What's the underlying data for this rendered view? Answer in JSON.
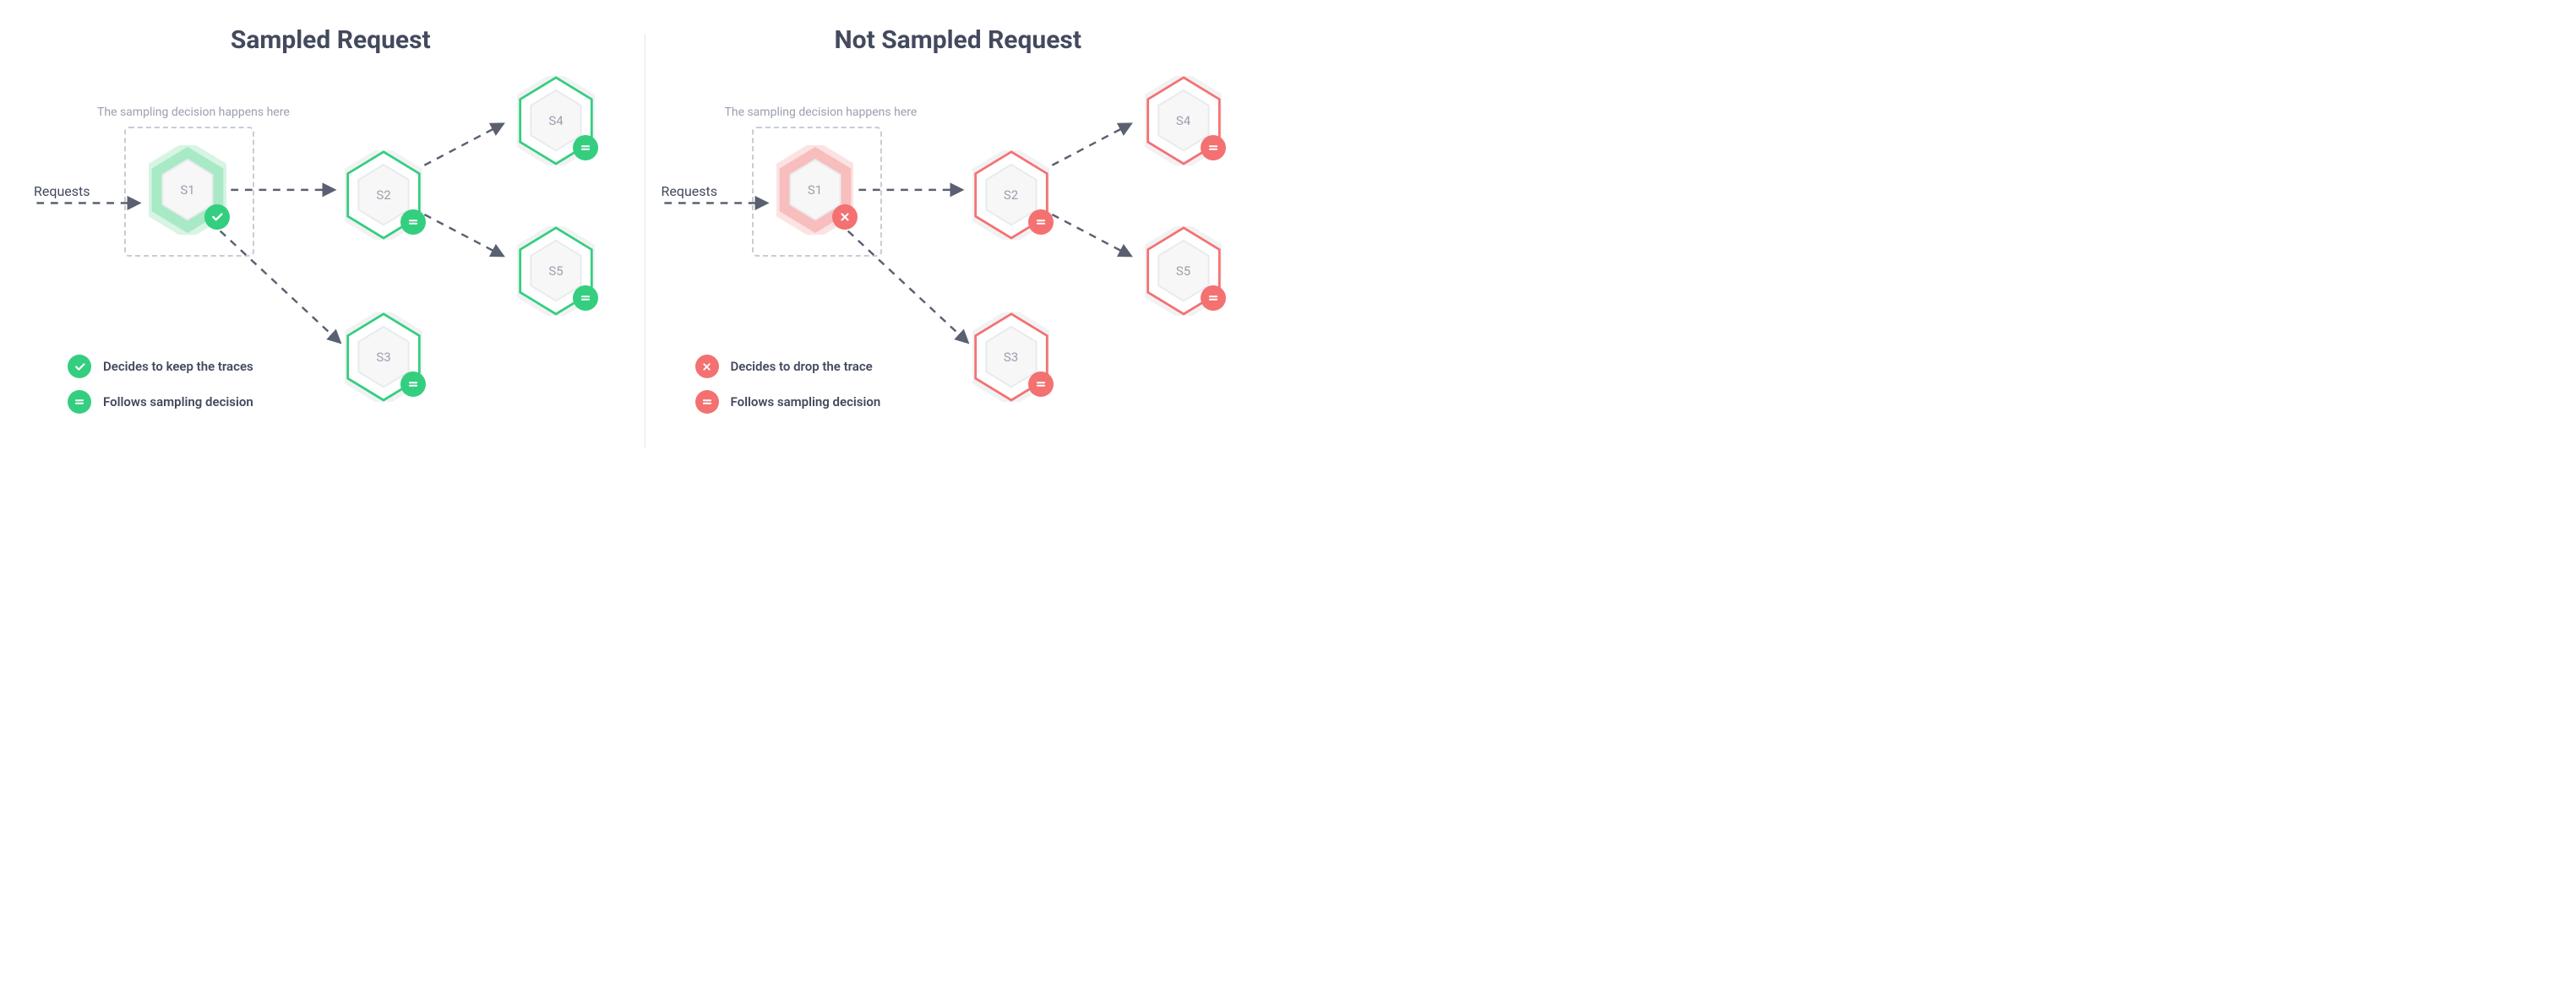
{
  "left": {
    "title": "Sampled Request",
    "caption": "The sampling decision happens here",
    "requests_label": "Requests",
    "nodes": {
      "s1": "S1",
      "s2": "S2",
      "s3": "S3",
      "s4": "S4",
      "s5": "S5"
    },
    "legend": {
      "decide": "Decides to keep the traces",
      "follow": "Follows sampling decision"
    },
    "color": "green"
  },
  "right": {
    "title": "Not Sampled Request",
    "caption": "The sampling decision happens here",
    "requests_label": "Requests",
    "nodes": {
      "s1": "S1",
      "s2": "S2",
      "s3": "S3",
      "s4": "S4",
      "s5": "S5"
    },
    "legend": {
      "decide": "Decides to drop the trace",
      "follow": "Follows sampling decision"
    },
    "color": "red"
  },
  "icons": {
    "check": "check-icon",
    "cross": "cross-icon",
    "equals": "equals-icon"
  }
}
